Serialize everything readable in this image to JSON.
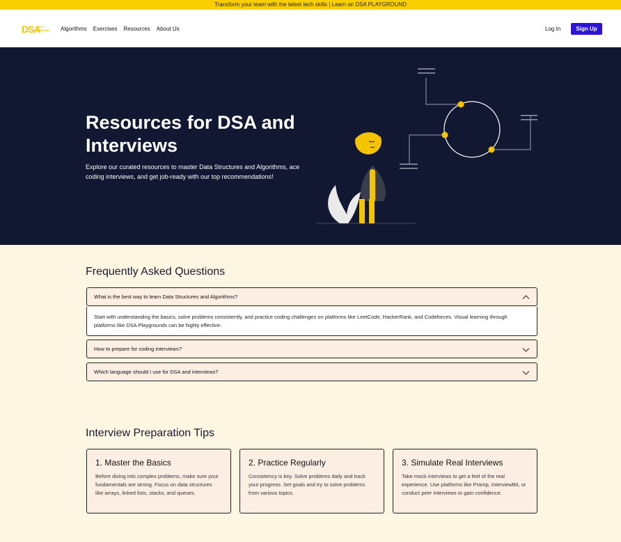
{
  "banner": {
    "text": "Transform your team with the latest tech skills | Learn on DSA PLAYGROUND"
  },
  "nav": {
    "logo_main": "DSA",
    "logo_sub_1": "PLAY",
    "logo_sub_2": "GROUND",
    "links": [
      "Algorithms",
      "Exercises",
      "Resources",
      "About Us"
    ],
    "login": "Log In",
    "signup": "Sign Up"
  },
  "hero": {
    "title": "Resources for DSA and Interviews",
    "subtitle": "Explore our curated resources to master Data Structures and Algorithms, ace coding interviews, and get job-ready with our top recommendations!"
  },
  "faq": {
    "title": "Frequently Asked Questions",
    "items": [
      {
        "question": "What is the best way to learn Data Structures and Algorithms?",
        "expanded": true,
        "answer": "Start with understanding the basics, solve problems consistently, and practice coding challenges on platforms like LeetCode, HackerRank, and Codeforces. Visual learning through platforms like DSA Playgrounds can be highly effective."
      },
      {
        "question": "How to prepare for coding interviews?",
        "expanded": false
      },
      {
        "question": "Which language should I use for DSA and interviews?",
        "expanded": false
      }
    ]
  },
  "tips": {
    "title": "Interview Preparation Tips",
    "cards": [
      {
        "title": "1. Master the Basics",
        "text": "Before diving into complex problems, make sure your fundamentals are strong. Focus on data structures like arrays, linked lists, stacks, and queues."
      },
      {
        "title": "2. Practice Regularly",
        "text": "Consistency is key. Solve problems daily and track your progress. Set goals and try to solve problems from various topics."
      },
      {
        "title": "3. Simulate Real Interviews",
        "text": "Take mock interviews to get a feel of the real experience. Use platforms like Pramp, InterviewBit, or conduct peer interviews to gain confidence."
      }
    ]
  },
  "colors": {
    "accent": "#f9cf00",
    "brand_button": "#2e14d6",
    "hero_bg": "#121832",
    "page_bg": "#fdf6e3",
    "card_bg": "#fdeee3"
  }
}
